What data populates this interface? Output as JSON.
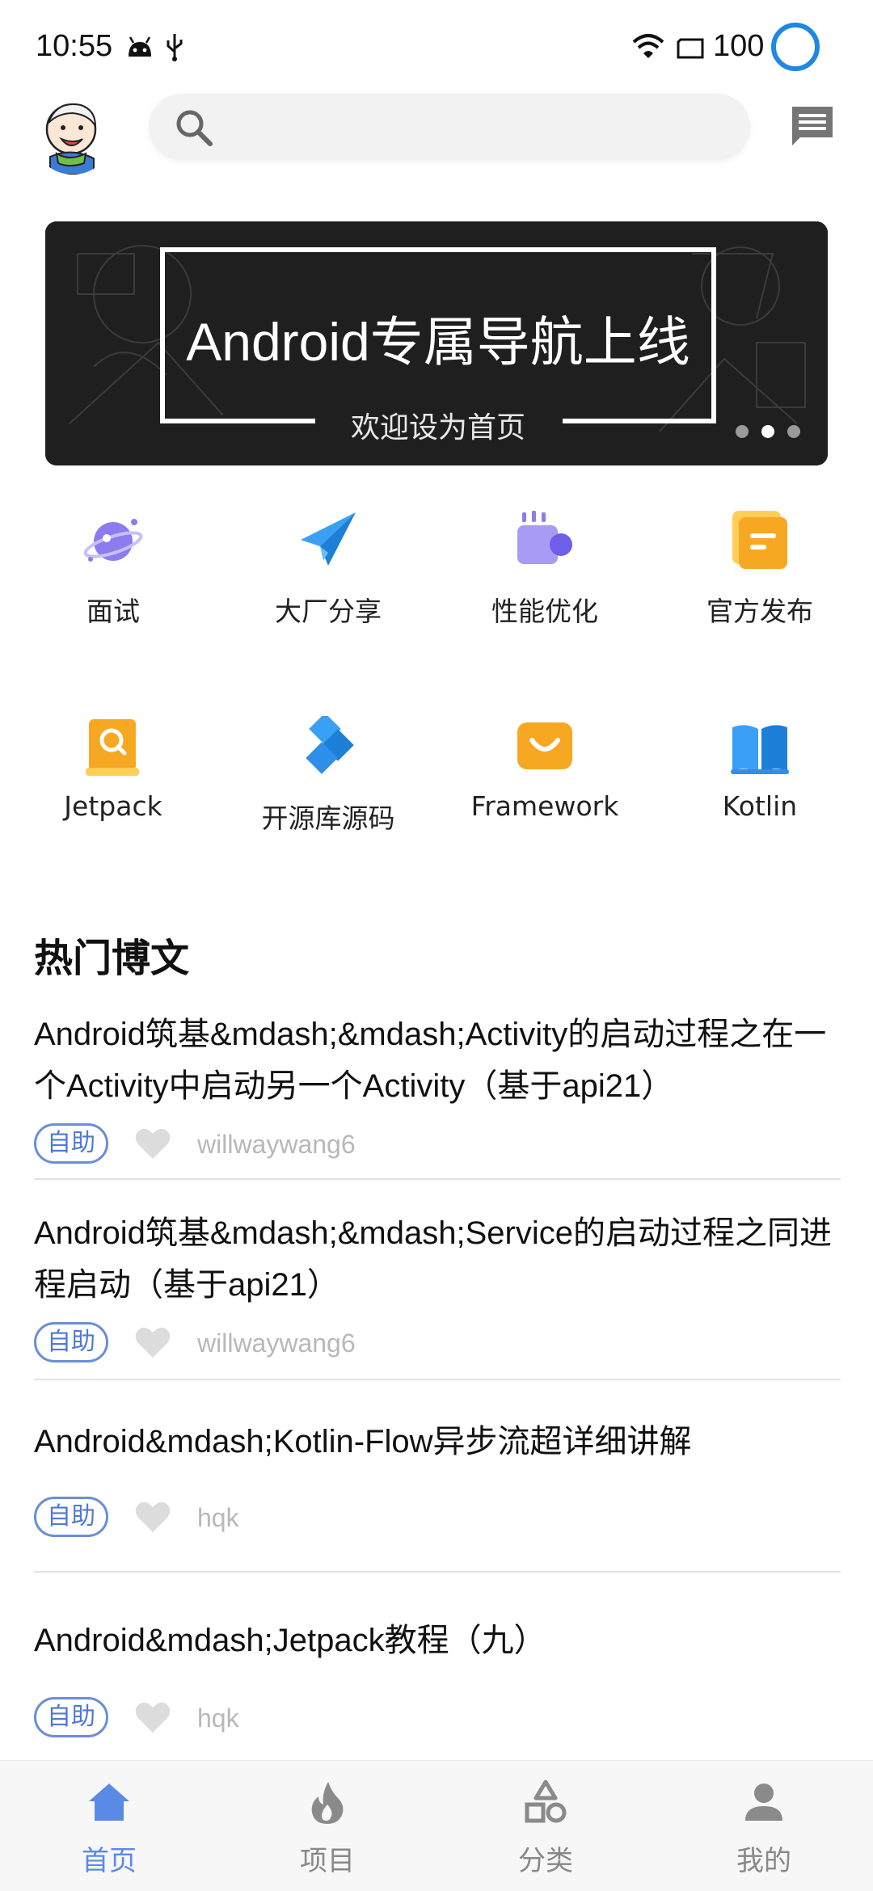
{
  "status_bar": {
    "time": "10:55",
    "battery": "100"
  },
  "banner": {
    "title": "Android专属导航上线",
    "subtitle": "欢迎设为首页",
    "dots": 3,
    "active_dot": 1
  },
  "categories": [
    {
      "label": "面试",
      "icon": "planet-icon"
    },
    {
      "label": "大厂分享",
      "icon": "paper-plane-icon"
    },
    {
      "label": "性能优化",
      "icon": "coffee-cup-icon"
    },
    {
      "label": "官方发布",
      "icon": "document-icon"
    },
    {
      "label": "Jetpack",
      "icon": "book-search-icon"
    },
    {
      "label": "开源库源码",
      "icon": "cubes-icon"
    },
    {
      "label": "Framework",
      "icon": "shopping-bag-icon"
    },
    {
      "label": "Kotlin",
      "icon": "open-book-icon"
    }
  ],
  "section": {
    "title": "热门博文"
  },
  "articles": [
    {
      "title": "Android筑基&mdash;&mdash;Activity的启动过程之在一个Activity中启动另一个Activity（基于api21）",
      "tag": "自助",
      "author": "willwaywang6"
    },
    {
      "title": "Android筑基&mdash;&mdash;Service的启动过程之同进程启动（基于api21）",
      "tag": "自助",
      "author": "willwaywang6"
    },
    {
      "title": "Android&mdash;Kotlin-Flow异步流超详细讲解",
      "tag": "自助",
      "author": "hqk"
    },
    {
      "title": "Android&mdash;Jetpack教程（九）",
      "tag": "自助",
      "author": "hqk"
    }
  ],
  "bottom_nav": [
    {
      "label": "首页",
      "icon": "home-icon",
      "active": true
    },
    {
      "label": "项目",
      "icon": "flame-icon",
      "active": false
    },
    {
      "label": "分类",
      "icon": "shapes-icon",
      "active": false
    },
    {
      "label": "我的",
      "icon": "person-icon",
      "active": false
    }
  ],
  "colors": {
    "accent": "#5b8ae6",
    "tag_border": "#6c8ed8",
    "status_ring": "#1e88e5"
  }
}
